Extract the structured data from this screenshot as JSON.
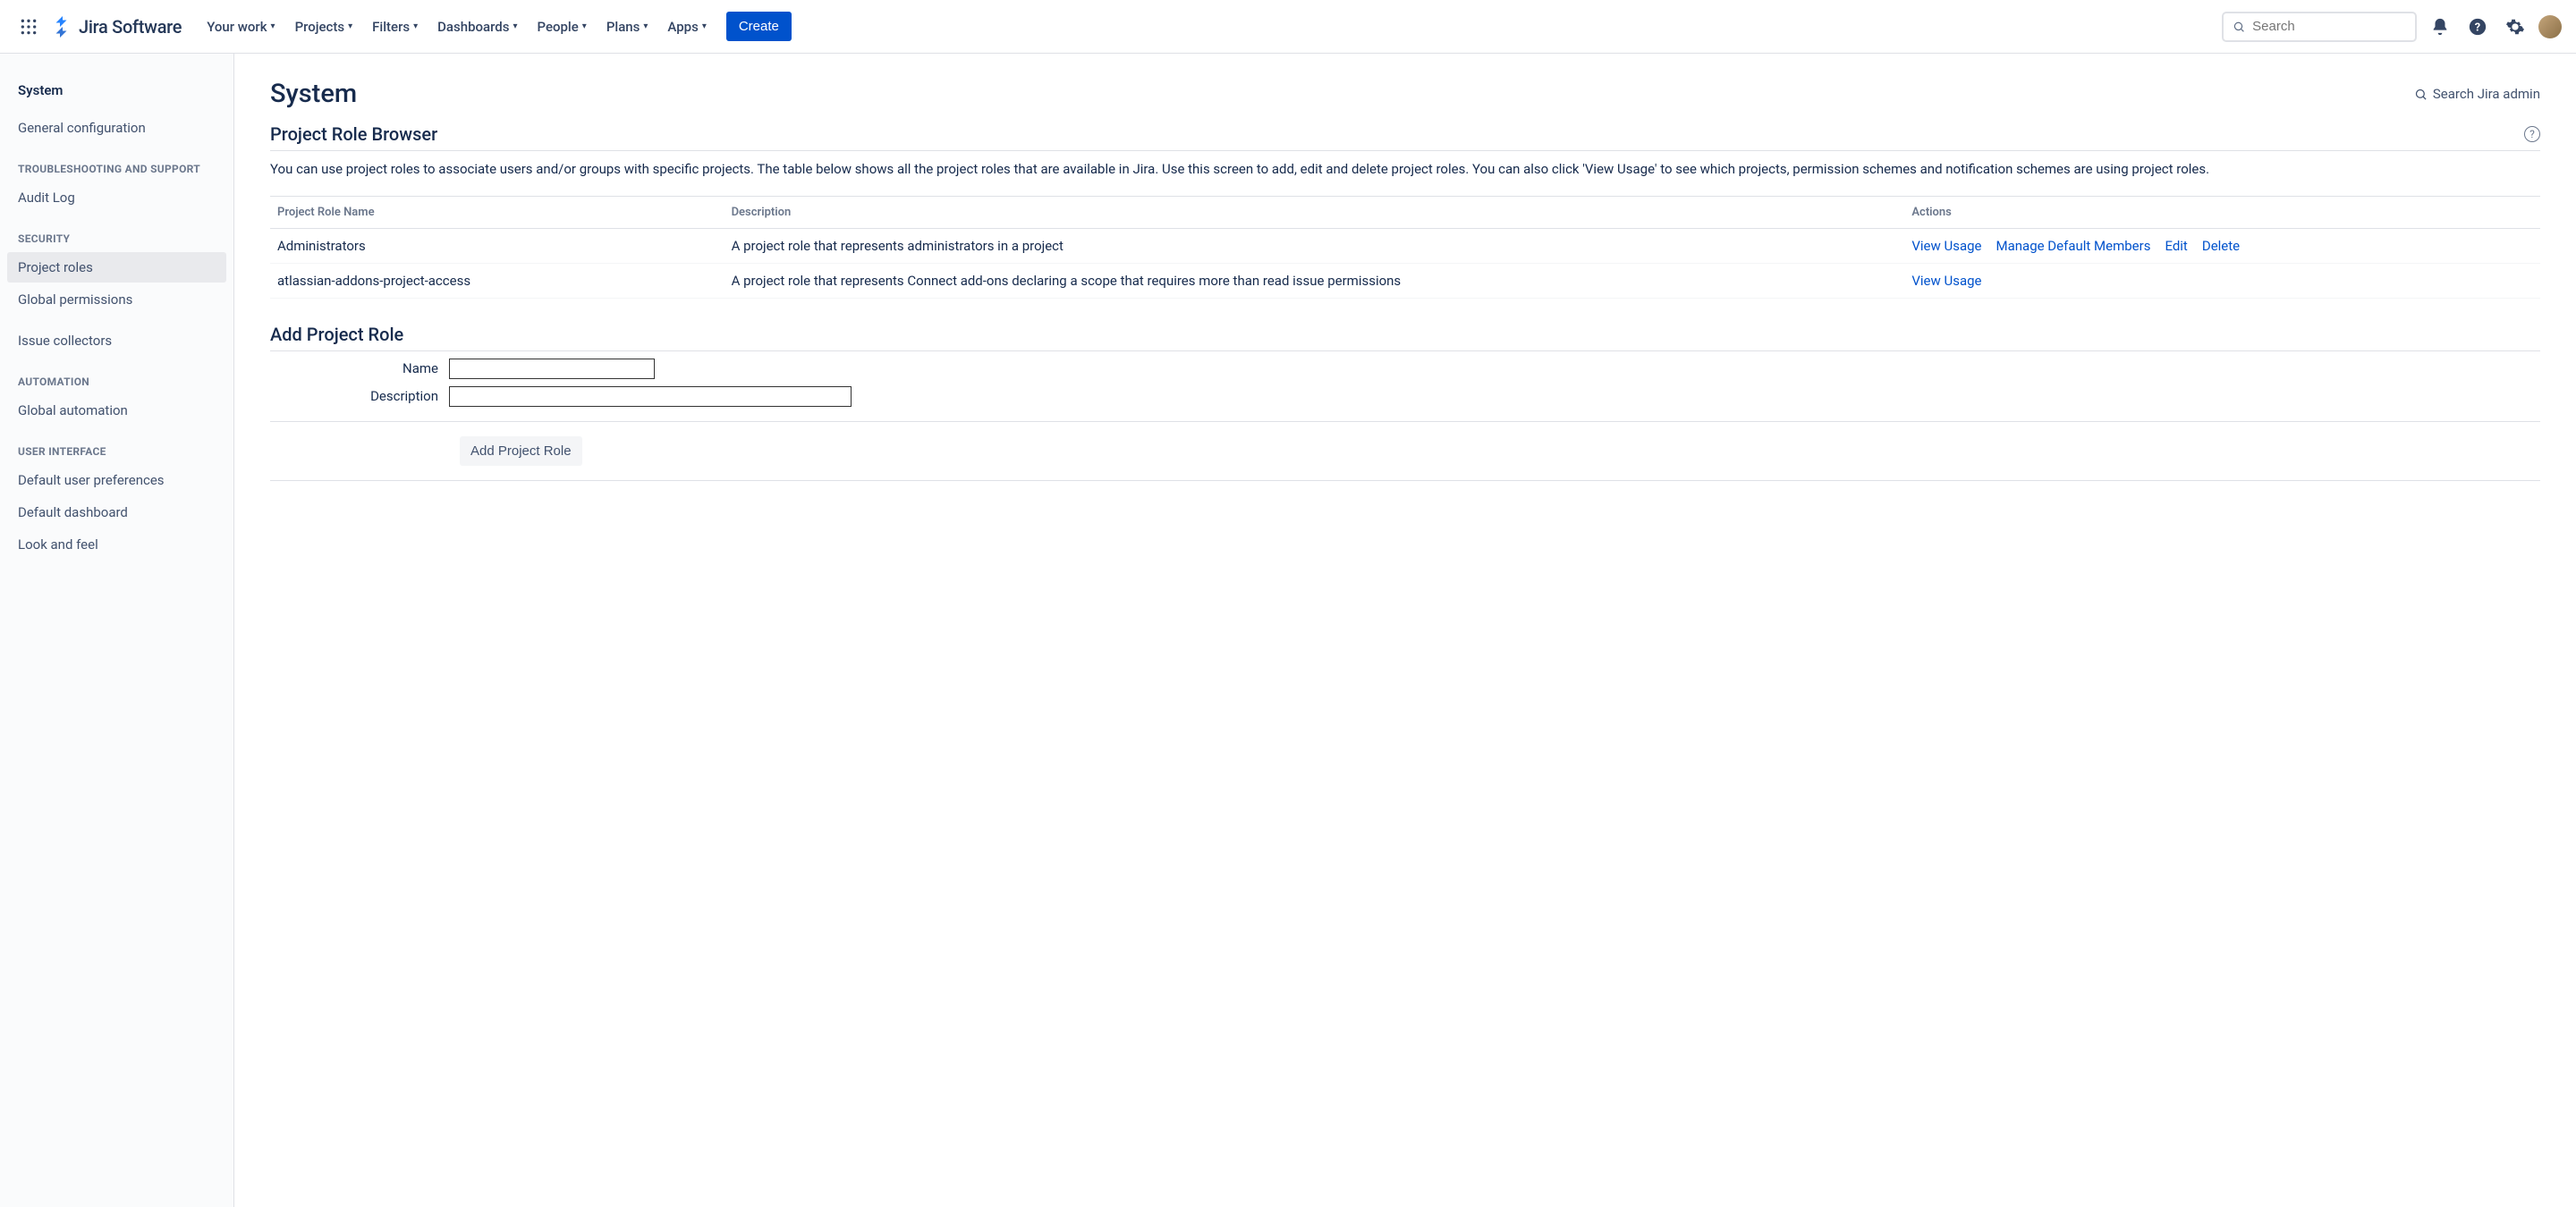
{
  "header": {
    "product_name": "Jira Software",
    "nav": [
      "Your work",
      "Projects",
      "Filters",
      "Dashboards",
      "People",
      "Plans",
      "Apps"
    ],
    "create_label": "Create",
    "search_placeholder": "Search"
  },
  "sidebar": {
    "title": "System",
    "items": [
      {
        "label": "General configuration",
        "active": false
      },
      {
        "section": "TROUBLESHOOTING AND SUPPORT"
      },
      {
        "label": "Audit Log",
        "active": false
      },
      {
        "section": "SECURITY"
      },
      {
        "label": "Project roles",
        "active": true
      },
      {
        "label": "Global permissions",
        "active": false
      },
      {
        "label": "Issue collectors",
        "active": false
      },
      {
        "section": "AUTOMATION"
      },
      {
        "label": "Global automation",
        "active": false
      },
      {
        "section": "USER INTERFACE"
      },
      {
        "label": "Default user preferences",
        "active": false
      },
      {
        "label": "Default dashboard",
        "active": false
      },
      {
        "label": "Look and feel",
        "active": false
      }
    ]
  },
  "main": {
    "page_title": "System",
    "search_admin_label": "Search Jira admin",
    "section_title": "Project Role Browser",
    "section_desc": "You can use project roles to associate users and/or groups with specific projects. The table below shows all the project roles that are available in Jira. Use this screen to add, edit and delete project roles. You can also click 'View Usage' to see which projects, permission schemes and notification schemes are using project roles.",
    "columns": [
      "Project Role Name",
      "Description",
      "Actions"
    ],
    "rows": [
      {
        "name": "Administrators",
        "desc": "A project role that represents administrators in a project",
        "actions": [
          "View Usage",
          "Manage Default Members",
          "Edit",
          "Delete"
        ]
      },
      {
        "name": "atlassian-addons-project-access",
        "desc": "A project role that represents Connect add-ons declaring a scope that requires more than read issue permissions",
        "actions": [
          "View Usage"
        ]
      }
    ],
    "add_section_title": "Add Project Role",
    "name_label": "Name",
    "description_label": "Description",
    "submit_label": "Add Project Role"
  }
}
